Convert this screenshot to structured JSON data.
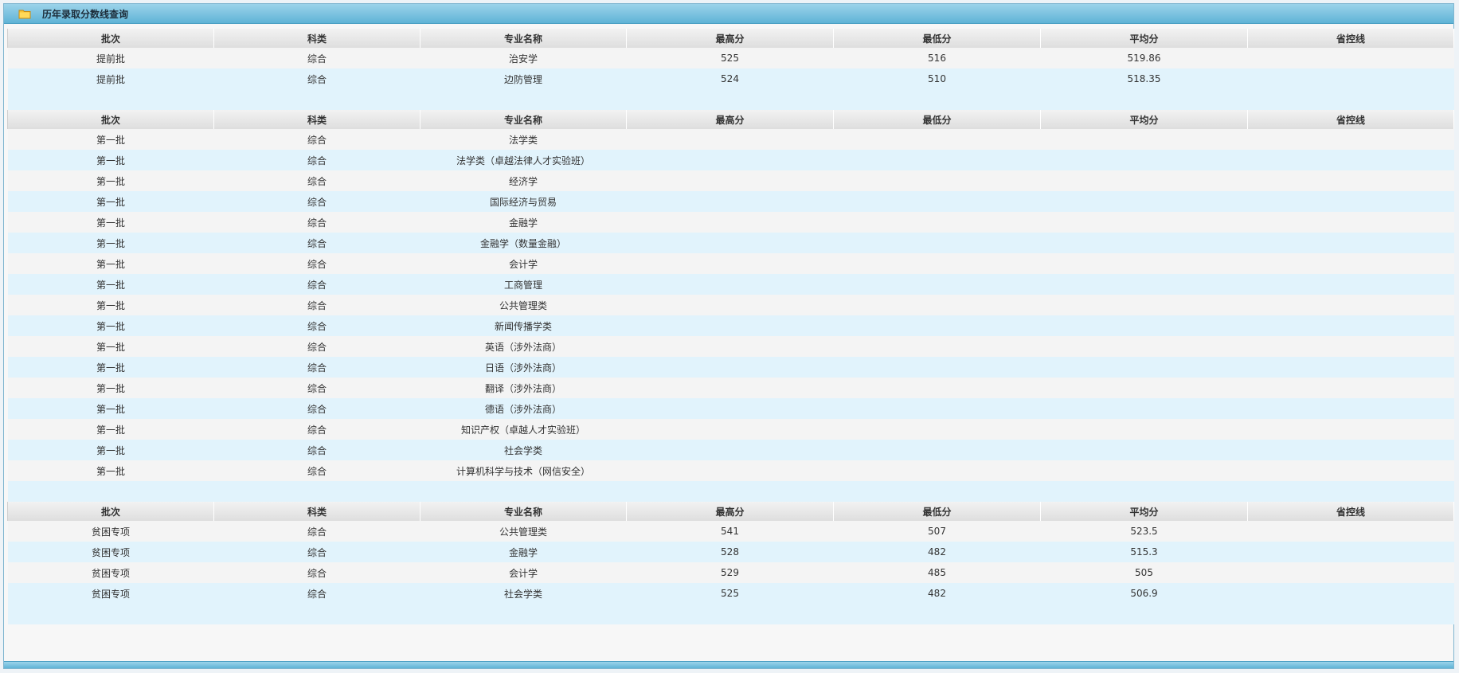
{
  "panel": {
    "title": "历年录取分数线查询"
  },
  "headers": [
    "批次",
    "科类",
    "专业名称",
    "最高分",
    "最低分",
    "平均分",
    "省控线"
  ],
  "tables": [
    {
      "rows": [
        [
          "提前批",
          "综合",
          "治安学",
          "525",
          "516",
          "519.86",
          ""
        ],
        [
          "提前批",
          "综合",
          "边防管理",
          "524",
          "510",
          "518.35",
          ""
        ]
      ]
    },
    {
      "rows": [
        [
          "第一批",
          "综合",
          "法学类",
          "",
          "",
          "",
          ""
        ],
        [
          "第一批",
          "综合",
          "法学类（卓越法律人才实验班）",
          "",
          "",
          "",
          ""
        ],
        [
          "第一批",
          "综合",
          "经济学",
          "",
          "",
          "",
          ""
        ],
        [
          "第一批",
          "综合",
          "国际经济与贸易",
          "",
          "",
          "",
          ""
        ],
        [
          "第一批",
          "综合",
          "金融学",
          "",
          "",
          "",
          ""
        ],
        [
          "第一批",
          "综合",
          "金融学（数量金融）",
          "",
          "",
          "",
          ""
        ],
        [
          "第一批",
          "综合",
          "会计学",
          "",
          "",
          "",
          ""
        ],
        [
          "第一批",
          "综合",
          "工商管理",
          "",
          "",
          "",
          ""
        ],
        [
          "第一批",
          "综合",
          "公共管理类",
          "",
          "",
          "",
          ""
        ],
        [
          "第一批",
          "综合",
          "新闻传播学类",
          "",
          "",
          "",
          ""
        ],
        [
          "第一批",
          "综合",
          "英语（涉外法商）",
          "",
          "",
          "",
          ""
        ],
        [
          "第一批",
          "综合",
          "日语（涉外法商）",
          "",
          "",
          "",
          ""
        ],
        [
          "第一批",
          "综合",
          "翻译（涉外法商）",
          "",
          "",
          "",
          ""
        ],
        [
          "第一批",
          "综合",
          "德语（涉外法商）",
          "",
          "",
          "",
          ""
        ],
        [
          "第一批",
          "综合",
          "知识产权（卓越人才实验班）",
          "",
          "",
          "",
          ""
        ],
        [
          "第一批",
          "综合",
          "社会学类",
          "",
          "",
          "",
          ""
        ],
        [
          "第一批",
          "综合",
          "计算机科学与技术（网信安全）",
          "",
          "",
          "",
          ""
        ]
      ]
    },
    {
      "rows": [
        [
          "贫困专项",
          "综合",
          "公共管理类",
          "541",
          "507",
          "523.5",
          ""
        ],
        [
          "贫困专项",
          "综合",
          "金融学",
          "528",
          "482",
          "515.3",
          ""
        ],
        [
          "贫困专项",
          "综合",
          "会计学",
          "529",
          "485",
          "505",
          ""
        ],
        [
          "贫困专项",
          "综合",
          "社会学类",
          "525",
          "482",
          "506.9",
          ""
        ]
      ]
    }
  ]
}
